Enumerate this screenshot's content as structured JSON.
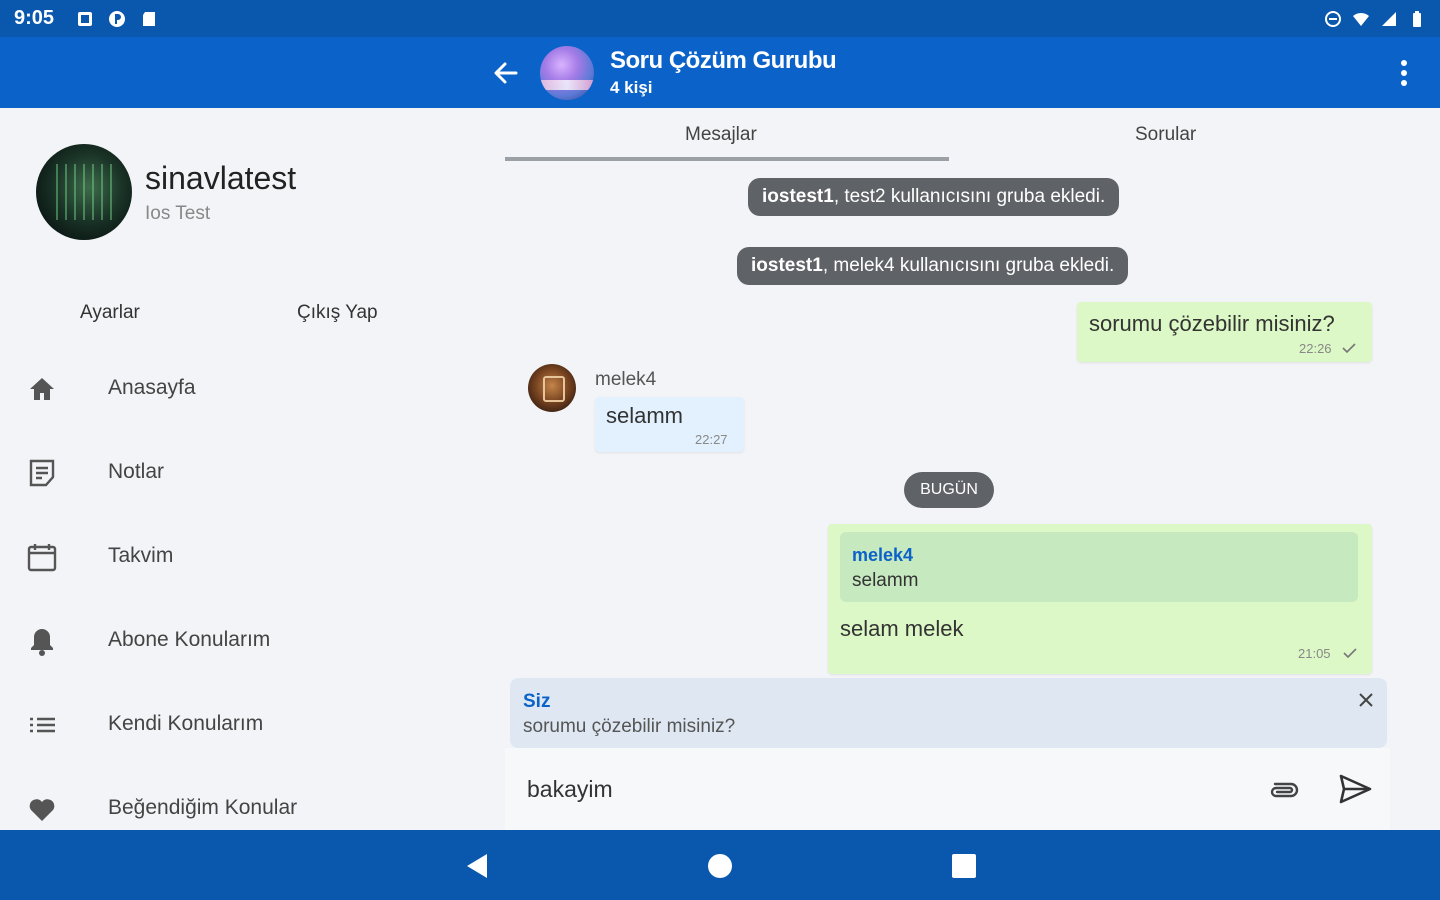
{
  "statusbar": {
    "time": "9:05",
    "left_icons": [
      "photo-icon",
      "vpn-icon",
      "sd-card-icon"
    ],
    "right_icons": [
      "dnd-icon",
      "wifi-icon",
      "signal-icon",
      "battery-icon"
    ]
  },
  "header": {
    "title": "Soru Çözüm Gurubu",
    "subtitle": "4 kişi",
    "back_icon": "arrow-left-icon",
    "menu_icon": "more-vert-icon"
  },
  "profile": {
    "name": "sinavlatest",
    "subtitle": "Ios Test",
    "settings_label": "Ayarlar",
    "logout_label": "Çıkış Yap"
  },
  "nav": {
    "items": [
      {
        "label": "Anasayfa",
        "icon": "home-icon"
      },
      {
        "label": "Notlar",
        "icon": "notes-icon"
      },
      {
        "label": "Takvim",
        "icon": "calendar-icon"
      },
      {
        "label": "Abone Konularım",
        "icon": "bell-icon"
      },
      {
        "label": "Kendi Konularım",
        "icon": "list-icon"
      },
      {
        "label": "Beğendiğim Konular",
        "icon": "heart-icon"
      }
    ]
  },
  "tabs": [
    {
      "label": "Mesajlar",
      "active": true
    },
    {
      "label": "Sorular",
      "active": false
    }
  ],
  "messages": {
    "system1": {
      "user": "iostest1",
      "text": ", test2 kullanıcısını gruba ekledi."
    },
    "system2": {
      "user": "iostest1",
      "text": ", melek4 kullanıcısını gruba ekledi."
    },
    "out1": {
      "text": "sorumu çözebilir misiniz?",
      "time": "22:26"
    },
    "in1": {
      "sender": "melek4",
      "text": "selamm",
      "time": "22:27"
    },
    "date_chip": "BUGÜN",
    "out2": {
      "quote_sender": "melek4",
      "quote_text": "selamm",
      "text": "selam melek",
      "time": "21:05"
    }
  },
  "reply_panel": {
    "sender": "Siz",
    "text": "sorumu çözebilir misiniz?",
    "close_icon": "close-icon"
  },
  "composer": {
    "value": "bakayim",
    "attach_icon": "attach-icon",
    "send_icon": "send-icon"
  },
  "system_nav": {
    "back_icon": "nav-back-icon",
    "home_icon": "nav-home-icon",
    "recents_icon": "nav-recents-icon"
  },
  "colors": {
    "statusbar": "#0a57ae",
    "appbar": "#0b63c9",
    "bubble_out": "#dcf8c6",
    "bubble_in": "#e3f0fd",
    "system_bubble": "#5f6266",
    "accent": "#0b63c9"
  }
}
